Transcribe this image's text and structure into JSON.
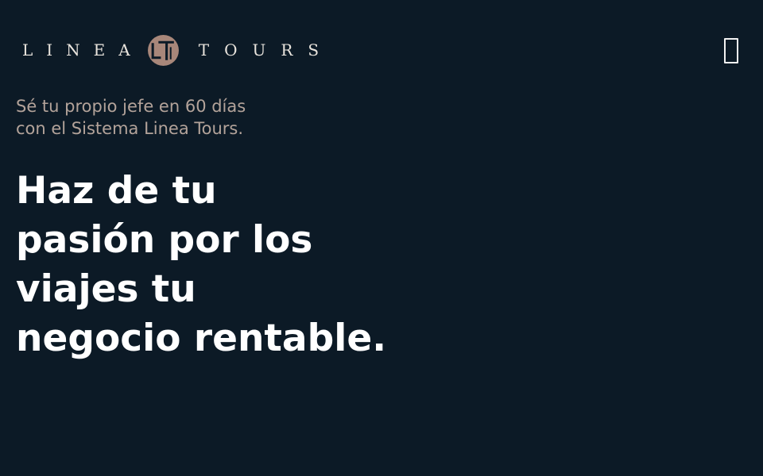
{
  "header": {
    "logo": {
      "word_left": "LINEA",
      "word_right": "TOURS",
      "emblem_icon": "lt-monogram-icon",
      "emblem_color": "#a8877a"
    },
    "menu_icon": "hamburger-menu-icon"
  },
  "hero": {
    "subtitle_lines": [
      "Sé tu propio jefe en 60 días",
      "con el Sistema Linea Tours."
    ],
    "headline_lines": [
      "Haz de tu",
      "pasión por los",
      "viajes tu",
      "negocio rentable."
    ]
  },
  "colors": {
    "background": "#0c1a26",
    "subtitle": "#b3a39a",
    "headline": "#ffffff",
    "logo_text": "#e9e4dd"
  }
}
